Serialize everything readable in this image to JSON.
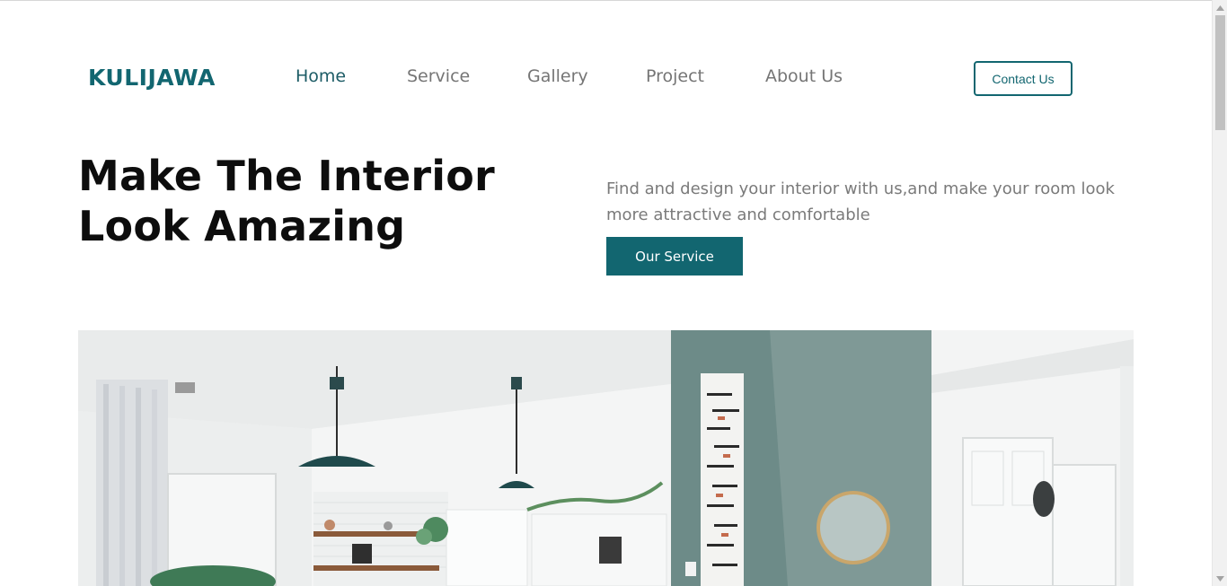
{
  "header": {
    "logo": "KULIJAWA",
    "nav": [
      {
        "label": "Home",
        "active": true
      },
      {
        "label": "Service",
        "active": false
      },
      {
        "label": "Gallery",
        "active": false
      },
      {
        "label": "Project",
        "active": false
      },
      {
        "label": "About Us",
        "active": false
      }
    ],
    "contact_label": "Contact Us"
  },
  "hero": {
    "title_line1": "Make The Interior",
    "title_line2": "Look Amazing",
    "description": "Find and design your interior with us,and make your room look more attractive and comfortable",
    "cta_label": "Our Service"
  },
  "colors": {
    "brand": "#126670",
    "nav_text": "#757575",
    "heading": "#0d0d0d",
    "body_text": "#7a7a7a"
  }
}
